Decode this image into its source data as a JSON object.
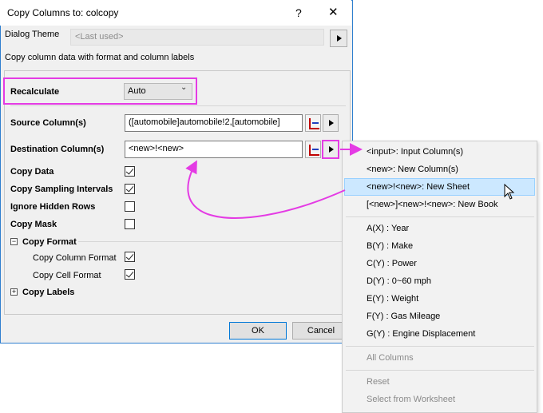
{
  "dialog": {
    "title": "Copy Columns to: colcopy",
    "help_label": "?",
    "close_label": "✕",
    "theme_label": "Dialog Theme",
    "theme_value": "<Last used>",
    "description": "Copy column data with format and column labels",
    "ok_label": "OK",
    "cancel_label": "Cancel"
  },
  "fields": {
    "recalculate_label": "Recalculate",
    "recalculate_value": "Auto",
    "source_label": "Source Column(s)",
    "source_value": "([automobile]automobile!2,[automobile]",
    "destination_label": "Destination Column(s)",
    "destination_value": "<new>!<new>"
  },
  "options": {
    "copy_data": {
      "label": "Copy Data",
      "checked": true
    },
    "copy_sampling": {
      "label": "Copy Sampling Intervals",
      "checked": true
    },
    "ignore_hidden": {
      "label": "Ignore Hidden Rows",
      "checked": false
    },
    "copy_mask": {
      "label": "Copy Mask",
      "checked": false
    },
    "copy_format": {
      "label": "Copy Format",
      "expander": "−",
      "column_format": {
        "label": "Copy Column Format",
        "checked": true
      },
      "cell_format": {
        "label": "Copy Cell Format",
        "checked": true
      }
    },
    "copy_labels": {
      "label": "Copy Labels",
      "expander": "+"
    }
  },
  "menu": {
    "items": [
      "<input>: Input Column(s)",
      "<new>: New Column(s)",
      "<new>!<new>: New Sheet",
      "[<new>]<new>!<new>: New Book",
      "A(X) : Year",
      "B(Y) : Make",
      "C(Y) : Power",
      "D(Y) : 0~60 mph",
      "E(Y) : Weight",
      "F(Y) : Gas Mileage",
      "G(Y) : Engine Displacement",
      "All Columns",
      "Reset",
      "Select from Worksheet"
    ],
    "highlighted_index": 2
  },
  "colors": {
    "annotation": "#e43be4",
    "menu_highlight": "#cce8ff",
    "window_border": "#2f7fcf"
  }
}
